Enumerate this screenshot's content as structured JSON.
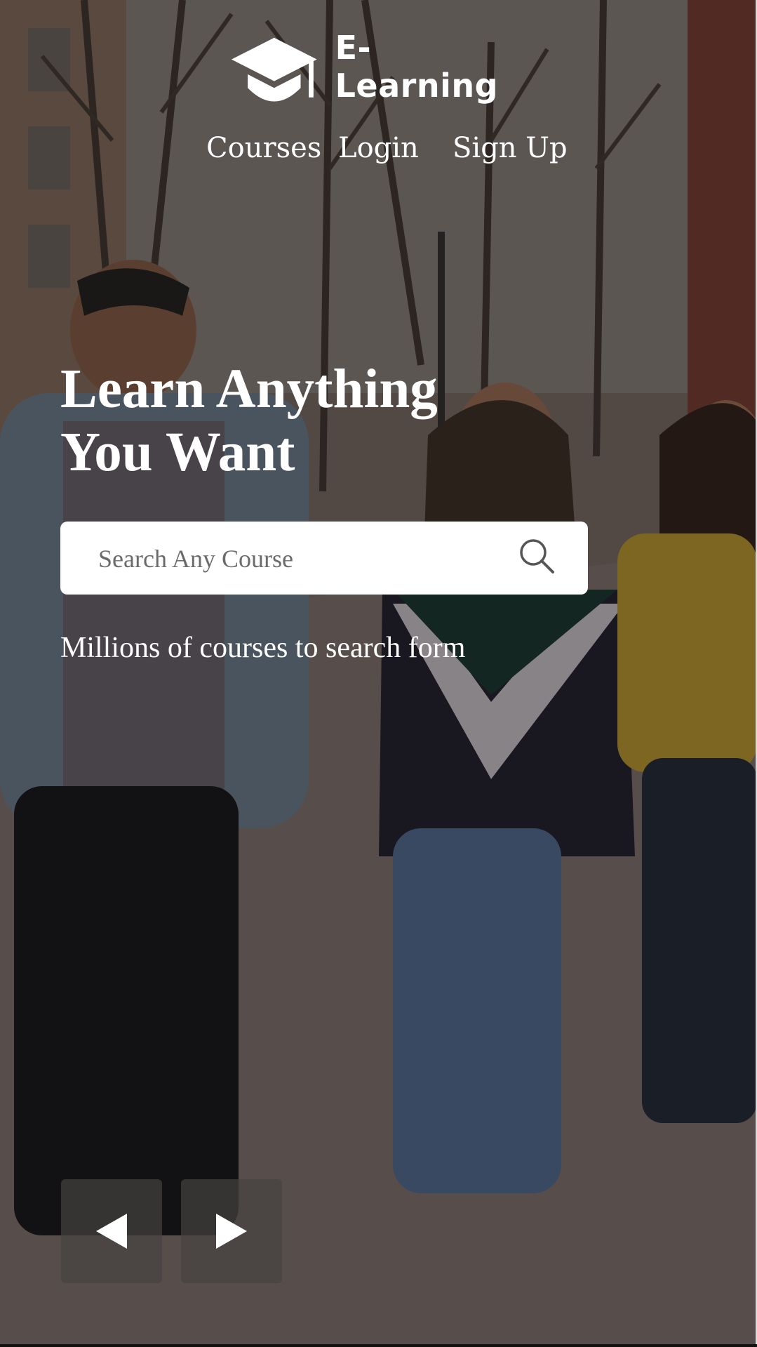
{
  "brand": {
    "name": "E-Learning"
  },
  "nav": {
    "items": [
      "Courses",
      "Login",
      "Sign Up"
    ]
  },
  "hero": {
    "title_line1": "Learn Anything",
    "title_line2": "You Want",
    "search_placeholder": "Search Any Course",
    "subtitle": "Millions of courses to search form"
  },
  "slider": {
    "prev_icon": "left-triangle-icon",
    "next_icon": "right-triangle-icon"
  },
  "colors": {
    "text": "#ffffff",
    "search_bg": "#ffffff",
    "placeholder": "#6b6b6b",
    "control_bg": "#464240"
  }
}
